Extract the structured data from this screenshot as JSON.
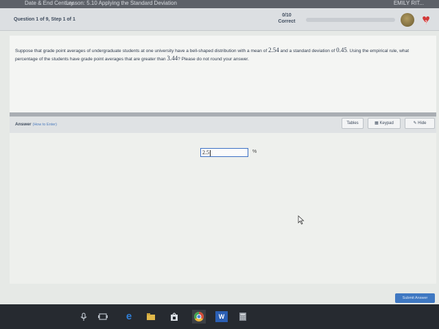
{
  "browser_strip": {
    "crumb": "Date & End Century",
    "lesson": "Lesson: 5.10 Applying the Standard Deviation",
    "user": "EMILY RIT..."
  },
  "header": {
    "question_label": "Question 1 of 9, Step 1 of 1",
    "score": "0/10",
    "score_status": "Correct",
    "progress_fraction": 0.0,
    "hearts": "2"
  },
  "question": {
    "part1": "Suppose that grade point averages of undergraduate students at one university have a bell-shaped distribution with a mean of",
    "mean": "2.54",
    "part2": "and a standard deviation of",
    "sd": "0.45",
    "part3": ". Using the empirical rule, what percentage of the students have grade point averages that are greater than",
    "threshold": "3.44",
    "part4": "? Please do not round your answer."
  },
  "answer_bar": {
    "label": "Answer",
    "how_to": "(How to Enter)",
    "tables": "Tables",
    "keypad": "Keypad",
    "hide": "Hide"
  },
  "answer": {
    "value": "2.5",
    "unit": "%"
  },
  "submit": "Submit Answer",
  "taskbar_icons": [
    "microphone-icon",
    "task-view-icon",
    "edge-icon",
    "file-explorer-icon",
    "store-icon",
    "chrome-icon",
    "word-icon",
    "calculator-icon"
  ],
  "colors": {
    "accent": "#3f78c2",
    "heart": "#d23a3a"
  }
}
